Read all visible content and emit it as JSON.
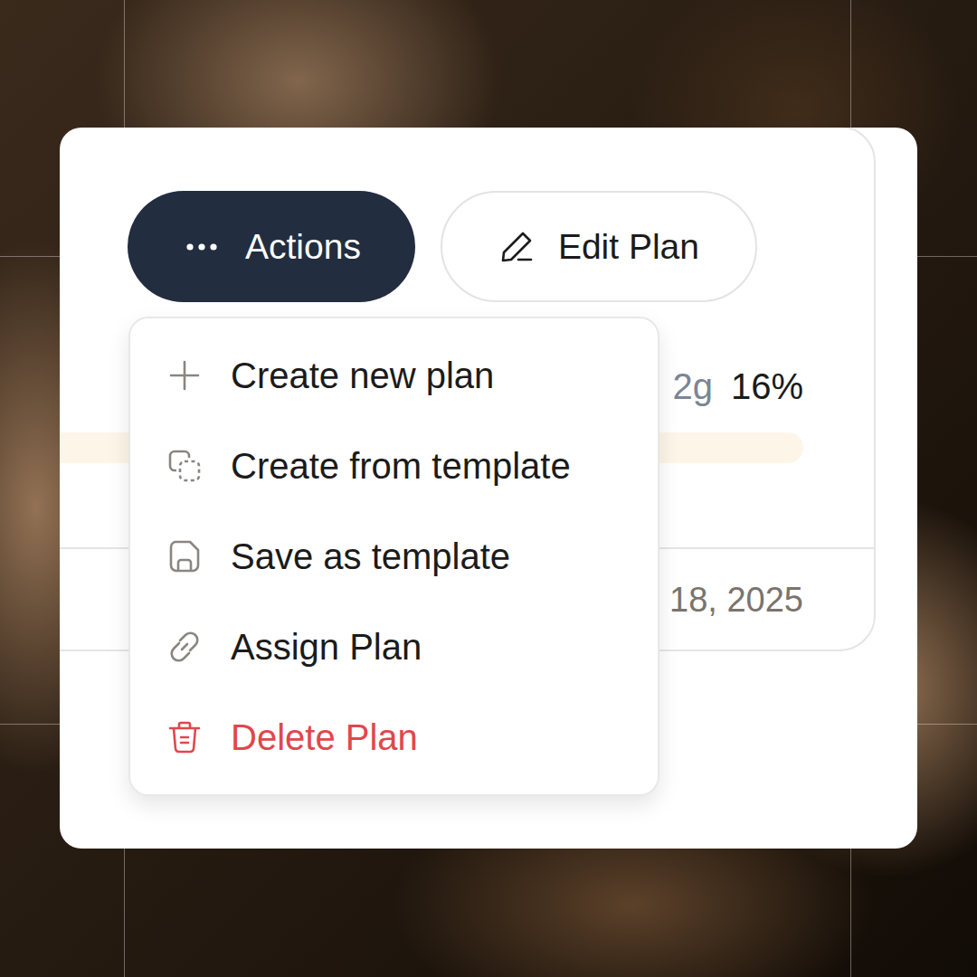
{
  "plan_card": {
    "actions_button": {
      "label": "Actions",
      "expanded": true
    },
    "edit_button": {
      "label": "Edit Plan"
    },
    "macro": {
      "amount": "2g",
      "percent": "16%"
    },
    "date": "18, 2025"
  },
  "actions_menu": {
    "items": [
      {
        "label": "Create new plan",
        "destructive": false
      },
      {
        "label": "Create from template",
        "destructive": false
      },
      {
        "label": "Save as template",
        "destructive": false
      },
      {
        "label": "Assign Plan",
        "destructive": false
      },
      {
        "label": "Delete Plan",
        "destructive": true
      }
    ]
  }
}
